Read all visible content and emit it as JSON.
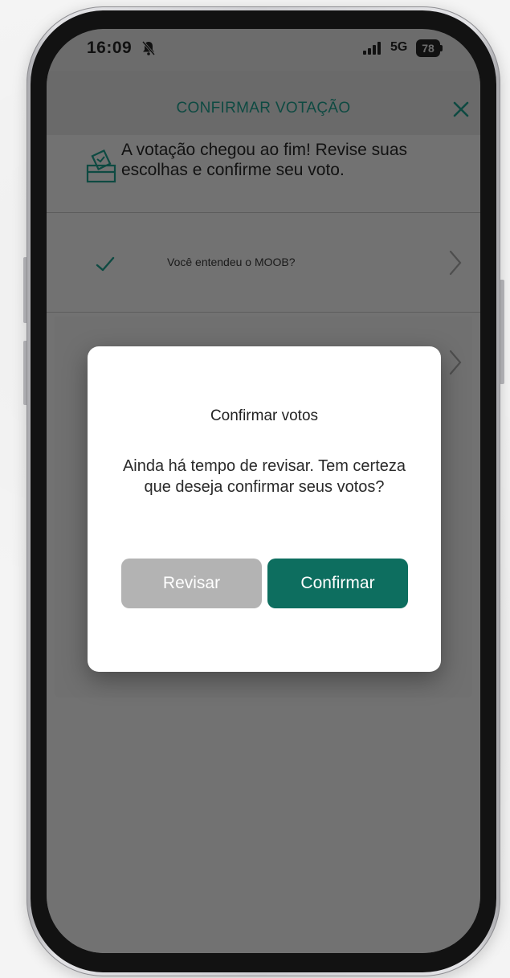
{
  "status_bar": {
    "time": "16:09",
    "network": "5G",
    "battery": "78",
    "icons": [
      "bell-off-icon",
      "signal-icon"
    ]
  },
  "header": {
    "title": "CONFIRMAR VOTAÇÃO",
    "close_icon": "close-icon"
  },
  "info": {
    "icon": "ballot-box-icon",
    "text": "A votação chegou ao fim! Revise suas escolhas e confirme seu voto."
  },
  "questions": [
    {
      "label": "Você entendeu o MOOB?",
      "status_icon": "check-icon",
      "nav_icon": "chevron-right-icon"
    }
  ],
  "dialog": {
    "title": "Confirmar votos",
    "message": "Ainda há tempo de revisar. Tem certeza que deseja confirmar seus votos?",
    "secondary_button": "Revisar",
    "primary_button": "Confirmar"
  },
  "colors": {
    "accent": "#0d6e5f",
    "header_text": "#0e4a42",
    "overlay": "#6c6c6c",
    "secondary_button": "#b3b3b3"
  }
}
